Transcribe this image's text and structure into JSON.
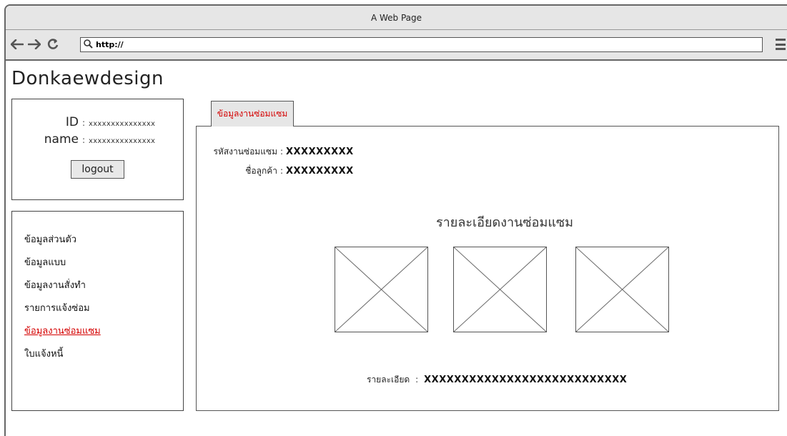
{
  "browser": {
    "title": "A Web Page",
    "url": "http://"
  },
  "site": {
    "title": "Donkaewdesign"
  },
  "user": {
    "id_label": "ID",
    "id_value": "xxxxxxxxxxxxxxx",
    "name_label": "name",
    "name_value": "xxxxxxxxxxxxxxx",
    "separator": ":",
    "logout_label": "logout"
  },
  "menu": {
    "items": [
      {
        "label": "ข้อมูลส่วนตัว",
        "active": false
      },
      {
        "label": "ข้อมูลแบบ",
        "active": false
      },
      {
        "label": "ข้อมูลงานสั่งทำ",
        "active": false
      },
      {
        "label": "รายการแจ้งซ่อม",
        "active": false
      },
      {
        "label": "ข้อมูลงานซ่อมแซม",
        "active": true
      },
      {
        "label": "ใบแจ้งหนี้",
        "active": false
      }
    ]
  },
  "main": {
    "tab_label": "ข้อมูลงานซ่อมแซม",
    "fields": {
      "code_label": "รหัสงานซ่อมแซม",
      "code_value": "XXXXXXXXX",
      "customer_label": "ชื่อลูกค้า",
      "customer_value": "XXXXXXXXX",
      "separator": ":"
    },
    "section_title": "รายละเอียดงานซ่อมแซม",
    "detail_label": "รายละเอียด",
    "detail_value": "XXXXXXXXXXXXXXXXXXXXXXXXXXX"
  },
  "colors": {
    "accent_red": "#d40000",
    "chrome_gray": "#e6e6e6",
    "border": "#555555"
  }
}
